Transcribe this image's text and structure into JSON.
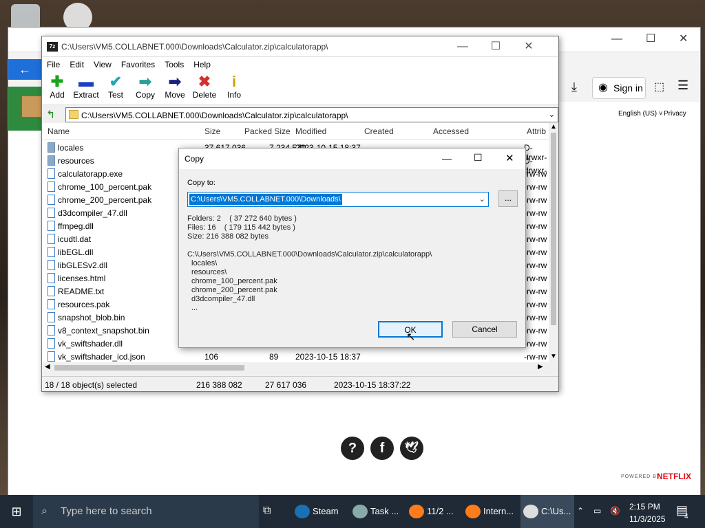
{
  "colors": {
    "accent": "#0078d7",
    "taskbar": "#1f2a36",
    "netflix": "#e50914"
  },
  "browser": {
    "signin_label": "Sign in",
    "language_label": "English (US) ˅",
    "privacy_label": "Privacy",
    "powered_by": "POWERED BY",
    "netflix": "NETFLIX",
    "footer_icons": [
      "help-icon",
      "facebook-icon",
      "twitter-icon"
    ]
  },
  "z7": {
    "title": "C:\\Users\\VM5.COLLABNET.000\\Downloads\\Calculator.zip\\calculatorapp\\",
    "app_icon": "7z",
    "menu": [
      "File",
      "Edit",
      "View",
      "Favorites",
      "Tools",
      "Help"
    ],
    "toolbar": [
      {
        "label": "Add",
        "icon": "plus-icon",
        "glyph": "✚",
        "color": "#1aa31a"
      },
      {
        "label": "Extract",
        "icon": "minus-icon",
        "glyph": "▬",
        "color": "#1a3fc4"
      },
      {
        "label": "Test",
        "icon": "checkmark-icon",
        "glyph": "✔",
        "color": "#22a6b3"
      },
      {
        "label": "Copy",
        "icon": "copy-arrow-icon",
        "glyph": "➡",
        "color": "#2aa198"
      },
      {
        "label": "Move",
        "icon": "move-arrow-icon",
        "glyph": "➡",
        "color": "#1a237e"
      },
      {
        "label": "Delete",
        "icon": "delete-x-icon",
        "glyph": "✖",
        "color": "#d32f2f"
      },
      {
        "label": "Info",
        "icon": "info-icon",
        "glyph": "i",
        "color": "#c9a000"
      }
    ],
    "address": "C:\\Users\\VM5.COLLABNET.000\\Downloads\\Calculator.zip\\calculatorapp\\",
    "columns": [
      "Name",
      "Size",
      "Packed Size",
      "Modified",
      "Created",
      "Accessed",
      "Attrib"
    ],
    "rows": [
      {
        "name": "locales",
        "folder": true,
        "size": "37 617 036",
        "packed": "7 234 570",
        "modified": "2023-10-15 18:37",
        "attrib": "D-drwxr-"
      },
      {
        "name": "resources",
        "folder": true,
        "size": "",
        "packed": "",
        "modified": "",
        "attrib": "D-drwxr-"
      },
      {
        "name": "calculatorapp.exe",
        "folder": false,
        "size": "",
        "packed": "",
        "modified": "",
        "attrib": "-rw-rw"
      },
      {
        "name": "chrome_100_percent.pak",
        "folder": false,
        "size": "",
        "packed": "",
        "modified": "",
        "attrib": "-rw-rw"
      },
      {
        "name": "chrome_200_percent.pak",
        "folder": false,
        "size": "",
        "packed": "",
        "modified": "",
        "attrib": "-rw-rw"
      },
      {
        "name": "d3dcompiler_47.dll",
        "folder": false,
        "size": "",
        "packed": "",
        "modified": "",
        "attrib": "-rw-rw"
      },
      {
        "name": "ffmpeg.dll",
        "folder": false,
        "size": "",
        "packed": "",
        "modified": "",
        "attrib": "-rw-rw"
      },
      {
        "name": "icudtl.dat",
        "folder": false,
        "size": "",
        "packed": "",
        "modified": "",
        "attrib": "-rw-rw"
      },
      {
        "name": "libEGL.dll",
        "folder": false,
        "size": "",
        "packed": "",
        "modified": "",
        "attrib": "-rw-rw"
      },
      {
        "name": "libGLESv2.dll",
        "folder": false,
        "size": "",
        "packed": "",
        "modified": "",
        "attrib": "-rw-rw"
      },
      {
        "name": "licenses.html",
        "folder": false,
        "size": "",
        "packed": "",
        "modified": "",
        "attrib": "-rw-rw"
      },
      {
        "name": "README.txt",
        "folder": false,
        "size": "",
        "packed": "",
        "modified": "",
        "attrib": "-rw-rw"
      },
      {
        "name": "resources.pak",
        "folder": false,
        "size": "",
        "packed": "",
        "modified": "",
        "attrib": "-rw-rw"
      },
      {
        "name": "snapshot_blob.bin",
        "folder": false,
        "size": "",
        "packed": "",
        "modified": "",
        "attrib": "-rw-rw"
      },
      {
        "name": "v8_context_snapshot.bin",
        "folder": false,
        "size": "",
        "packed": "",
        "modified": "",
        "attrib": "-rw-rw"
      },
      {
        "name": "vk_swiftshader.dll",
        "folder": false,
        "size": "",
        "packed": "",
        "modified": "",
        "attrib": "-rw-rw"
      },
      {
        "name": "vk_swiftshader_icd.json",
        "folder": false,
        "size": "106",
        "packed": "89",
        "modified": "2023-10-15 18:37",
        "attrib": "-rw-rw"
      }
    ],
    "status": {
      "selected": "18 / 18 object(s) selected",
      "size": "216 388 082",
      "packed": "27 617 036",
      "modified": "2023-10-15 18:37:22"
    }
  },
  "dialog": {
    "title": "Copy",
    "copy_to_label": "Copy to:",
    "path_value": "C:\\Users\\VM5.COLLABNET.000\\Downloads\\",
    "browse_label": "...",
    "folders": "Folders: 2    ( 37 272 640 bytes )",
    "files": "Files: 16    ( 179 115 442 bytes )",
    "size": "Size: 216 388 082 bytes",
    "source_path": "C:\\Users\\VM5.COLLABNET.000\\Downloads\\Calculator.zip\\calculatorapp\\",
    "items": [
      "locales\\",
      "resources\\",
      "chrome_100_percent.pak",
      "chrome_200_percent.pak",
      "d3dcompiler_47.dll",
      "..."
    ],
    "ok_label": "OK",
    "cancel_label": "Cancel"
  },
  "taskbar": {
    "search_placeholder": "Type here to search",
    "apps": [
      {
        "label": "Steam",
        "icon": "steam-icon",
        "color": "#1b6fb5"
      },
      {
        "label": "Task ...",
        "icon": "task-manager-icon",
        "color": "#8aa"
      },
      {
        "label": "11/2 ...",
        "icon": "firefox-icon",
        "color": "#ff7b1c"
      },
      {
        "label": "Intern...",
        "icon": "firefox-icon",
        "color": "#ff7b1c"
      },
      {
        "label": "C:\\Us...",
        "icon": "7zip-icon",
        "color": "#ddd"
      }
    ],
    "time": "2:15 PM",
    "date": "11/3/2025",
    "notifications": "4"
  }
}
